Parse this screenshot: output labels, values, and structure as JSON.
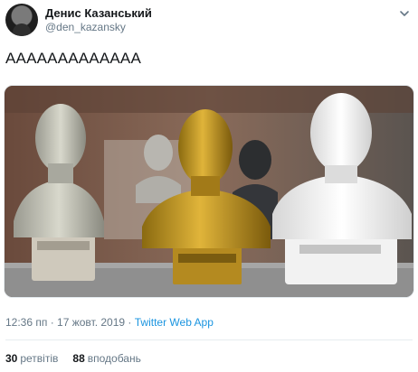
{
  "author": {
    "name": "Денис Казанський",
    "handle": "@den_kazansky"
  },
  "tweet": {
    "text": "ААААААААААААА"
  },
  "meta": {
    "time": "12:36 пп",
    "sep": " · ",
    "date": "17 жовт. 2019",
    "source": "Twitter Web App"
  },
  "stats": {
    "retweets_count": "30",
    "retweets_label": "ретвітів",
    "likes_count": "88",
    "likes_label": "вподобань"
  },
  "icons": {
    "caret": "chevron-down-icon"
  }
}
